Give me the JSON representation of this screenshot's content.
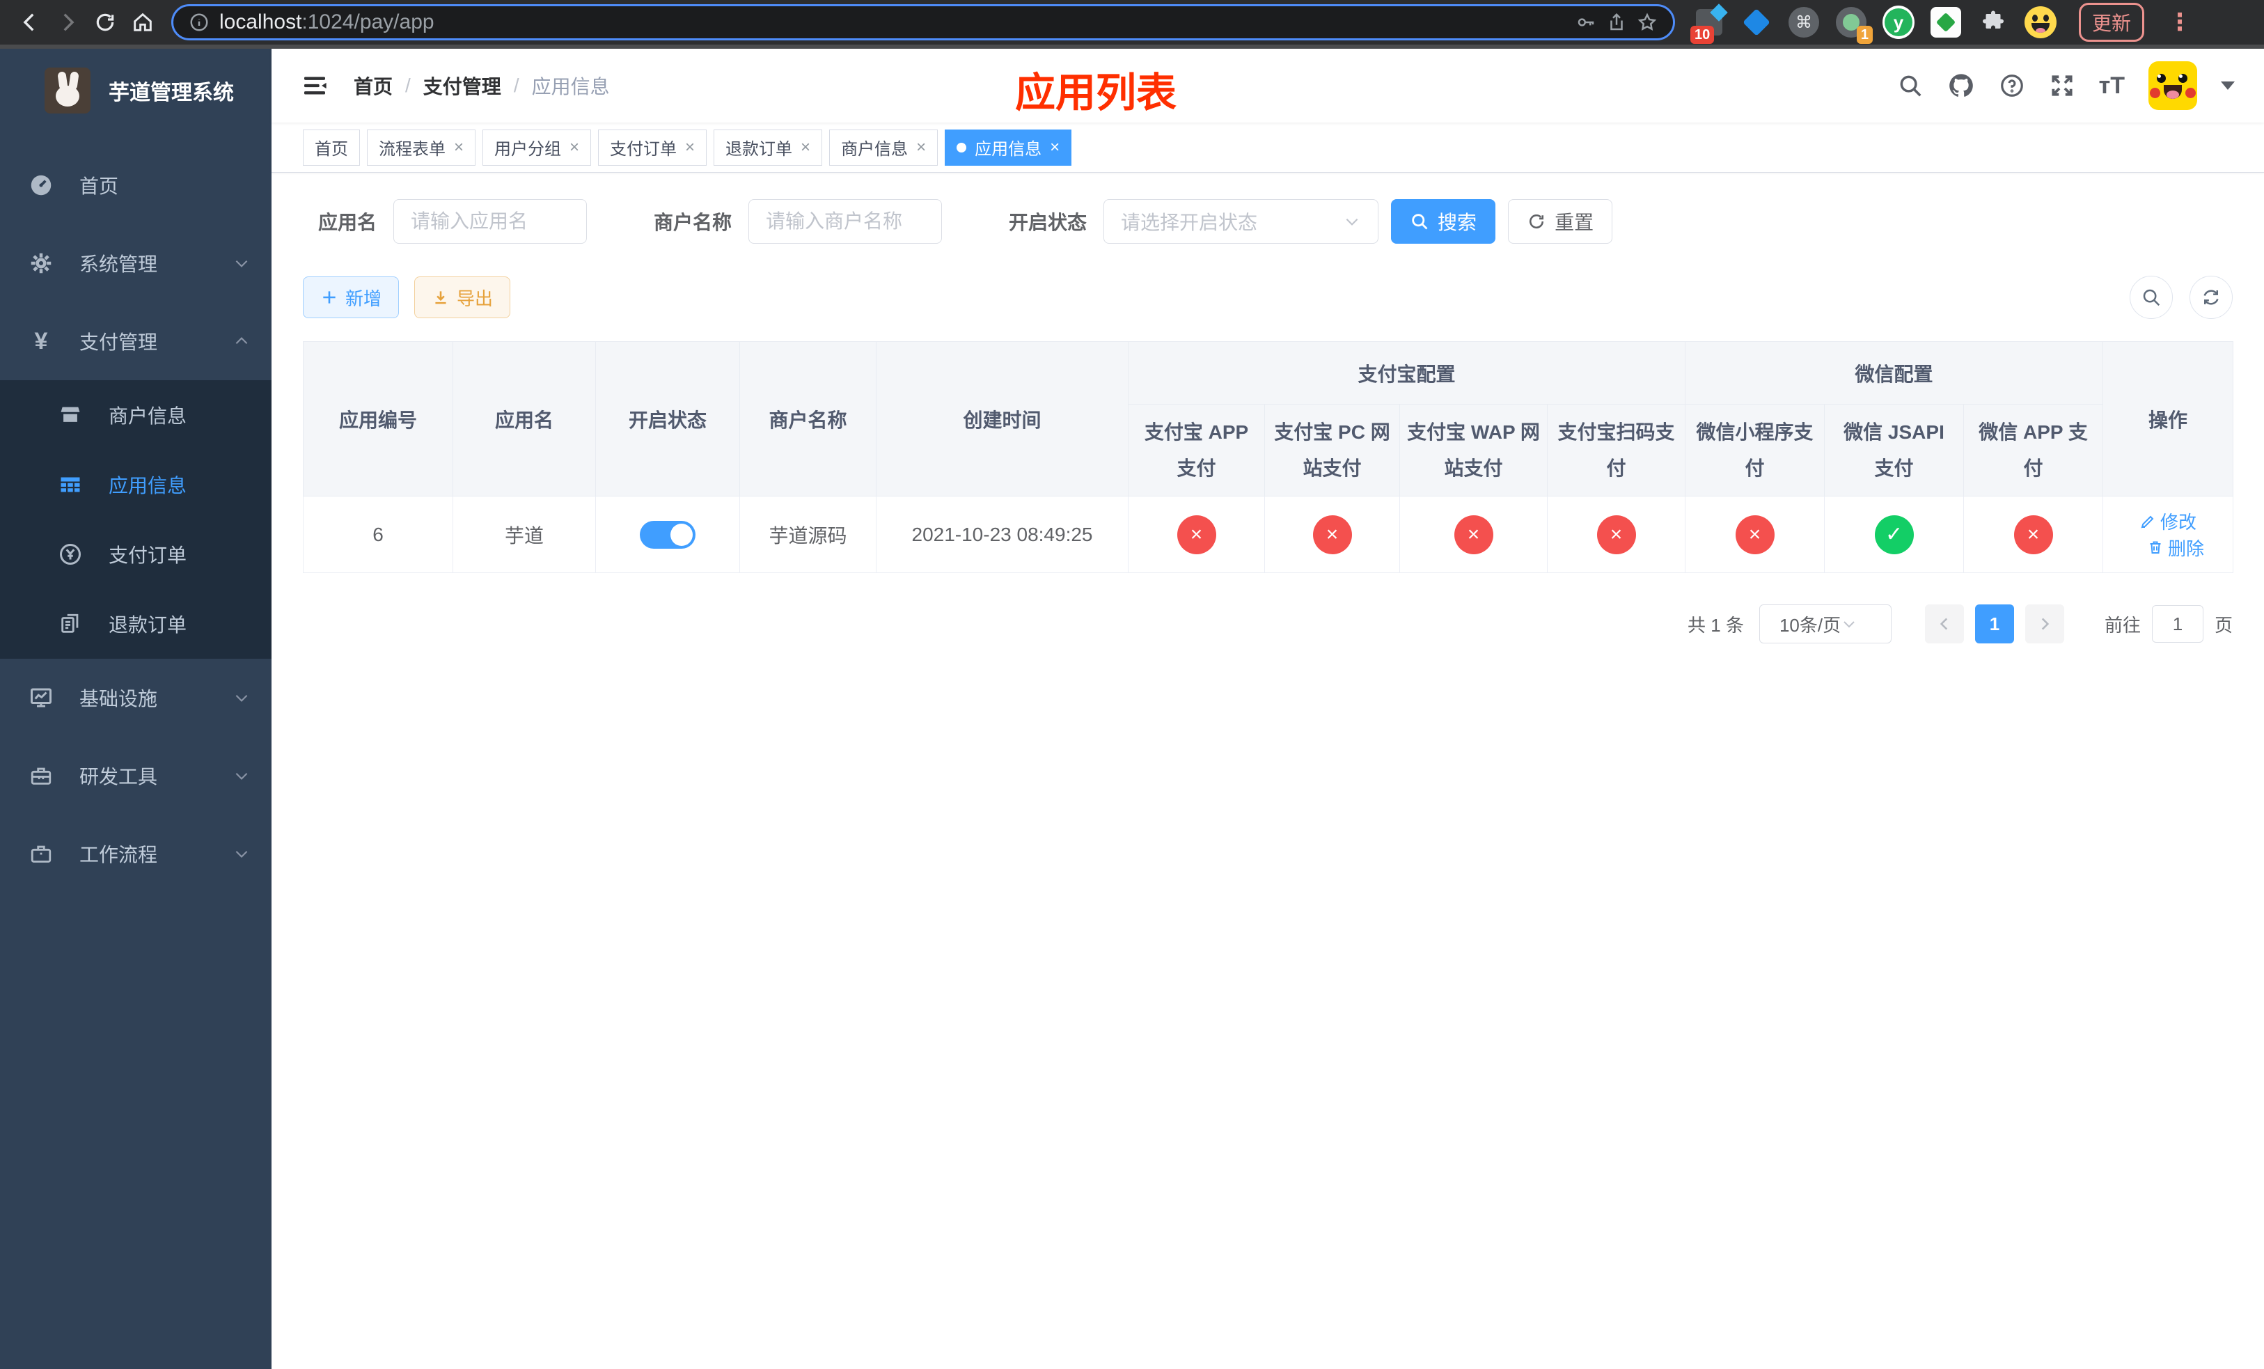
{
  "theme": {
    "primary": "#409eff",
    "success": "#13ce66",
    "danger": "#f4504e",
    "warning": "#e6a23c",
    "sidebar-bg": "#304156",
    "submenu-bg": "#1f2d3d",
    "overlay-red": "#ff2f00"
  },
  "browser": {
    "url_host": "localhost",
    "url_rest": ":1024/pay/app",
    "ext_badge_ten": "10",
    "ext_badge_one": "1",
    "ext_y_label": "y",
    "ext_cmd_glyph": "⌘",
    "update_label": "更新",
    "kebab_glyph": "⋮"
  },
  "sidebar": {
    "app_title": "芋道管理系统",
    "items": [
      {
        "label": "首页"
      },
      {
        "label": "系统管理"
      },
      {
        "label": "支付管理"
      },
      {
        "label": "商户信息"
      },
      {
        "label": "应用信息"
      },
      {
        "label": "支付订单"
      },
      {
        "label": "退款订单"
      },
      {
        "label": "基础设施"
      },
      {
        "label": "研发工具"
      },
      {
        "label": "工作流程"
      }
    ],
    "yen_glyph": "¥"
  },
  "header": {
    "breadcrumb": [
      {
        "label": "首页"
      },
      {
        "label": "支付管理"
      },
      {
        "label": "应用信息"
      }
    ],
    "separator": "/",
    "overlay_title": "应用列表"
  },
  "tabs": [
    {
      "label": "首页"
    },
    {
      "label": "流程表单",
      "close": "×"
    },
    {
      "label": "用户分组",
      "close": "×"
    },
    {
      "label": "支付订单",
      "close": "×"
    },
    {
      "label": "退款订单",
      "close": "×"
    },
    {
      "label": "商户信息",
      "close": "×"
    },
    {
      "label": "应用信息",
      "close": "×"
    }
  ],
  "filters": {
    "app_name_label": "应用名",
    "app_name_placeholder": "请输入应用名",
    "merchant_label": "商户名称",
    "merchant_placeholder": "请输入商户名称",
    "status_label": "开启状态",
    "status_placeholder": "请选择开启状态",
    "search_label": "搜索",
    "reset_label": "重置"
  },
  "toolbar": {
    "add_label": "新增",
    "export_label": "导出"
  },
  "table": {
    "groups": {
      "alipay": "支付宝配置",
      "wechat": "微信配置"
    },
    "columns": {
      "app_id": "应用编号",
      "app_name": "应用名",
      "status": "开启状态",
      "merchant": "商户名称",
      "created": "创建时间",
      "alipay_app": "支付宝 APP 支付",
      "alipay_pc": "支付宝 PC 网站支付",
      "alipay_wap": "支付宝 WAP 网站支付",
      "alipay_scan": "支付宝扫码支付",
      "wx_mini": "微信小程序支付",
      "wx_jsapi": "微信 JSAPI 支付",
      "wx_app": "微信 APP 支付",
      "actions": "操作"
    },
    "row": {
      "app_id": "6",
      "app_name": "芋道",
      "merchant": "芋道源码",
      "created": "2021-10-23 08:49:25",
      "channels": [
        {
          "glyph": "×",
          "cls": "status-circle red"
        },
        {
          "glyph": "×",
          "cls": "status-circle red"
        },
        {
          "glyph": "×",
          "cls": "status-circle red"
        },
        {
          "glyph": "×",
          "cls": "status-circle red"
        },
        {
          "glyph": "×",
          "cls": "status-circle red"
        },
        {
          "glyph": "✓",
          "cls": "status-circle green"
        },
        {
          "glyph": "×",
          "cls": "status-circle red"
        }
      ],
      "edit_label": "修改",
      "delete_label": "删除"
    }
  },
  "pagination": {
    "total": "共 1 条",
    "page_size": "10条/页",
    "page": "1",
    "goto_label": "前往",
    "goto_value": "1",
    "unit_label": "页"
  }
}
